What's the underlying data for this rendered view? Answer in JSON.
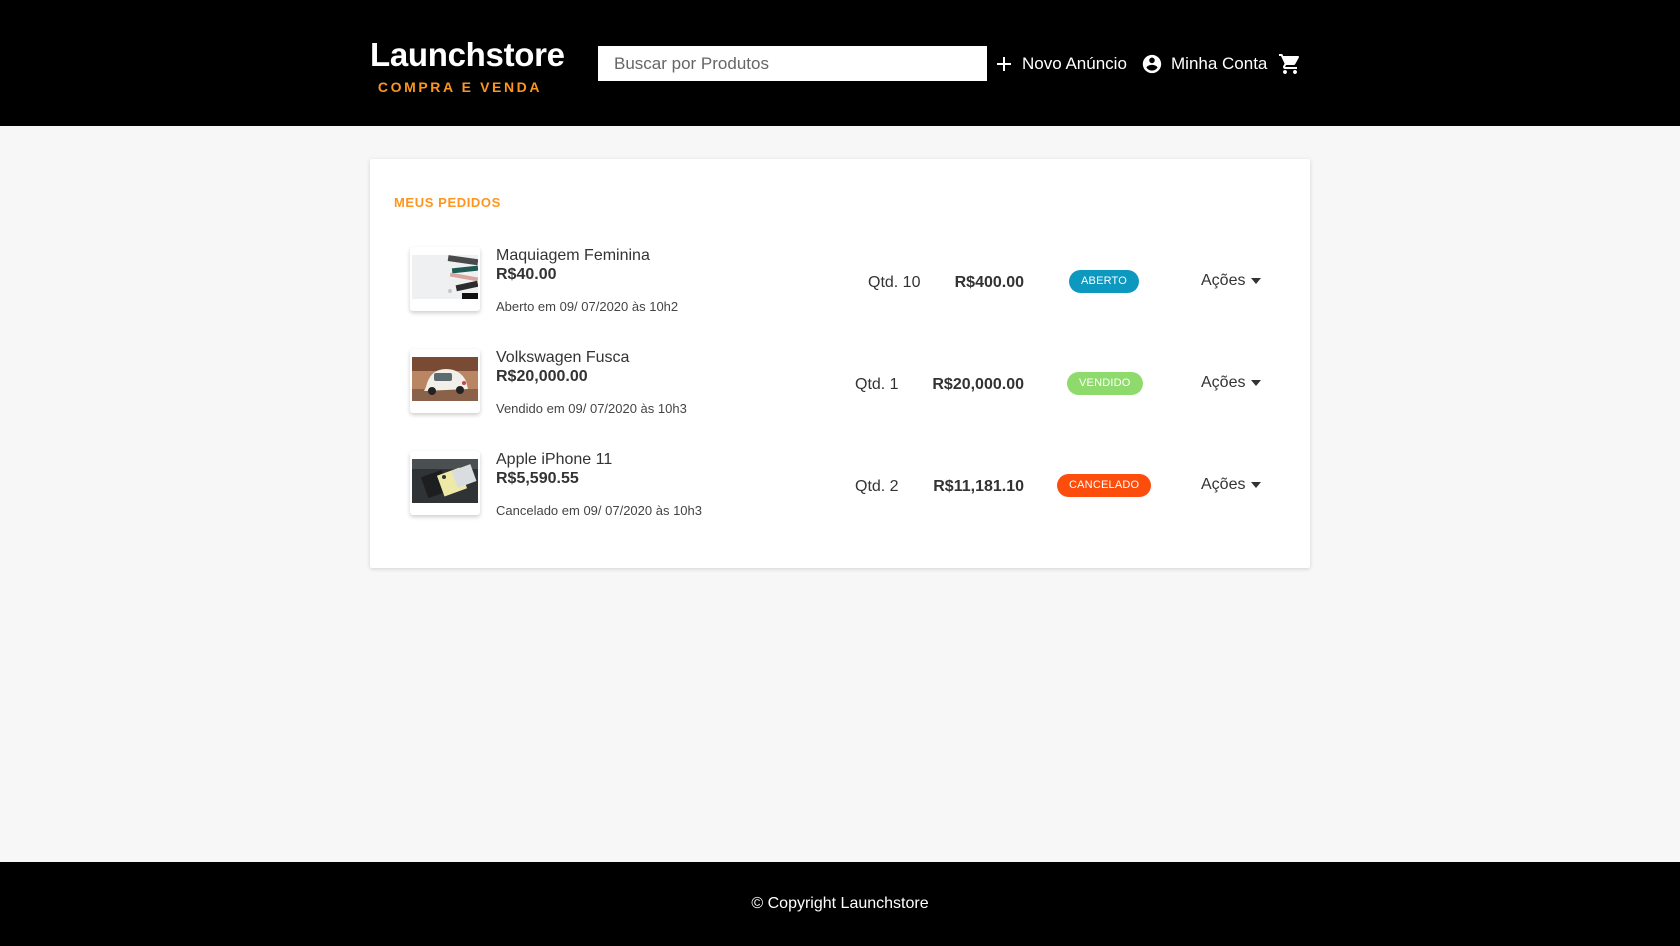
{
  "header": {
    "logo_title": "Launchstore",
    "logo_subtitle": "COMPRA E VENDA",
    "search_placeholder": "Buscar por Produtos",
    "new_ad_label": "Novo Anúncio",
    "account_label": "Minha Conta"
  },
  "orders_section": {
    "title": "MEUS PEDIDOS",
    "orders": [
      {
        "name": "Maquiagem Feminina",
        "unit_price": "R$40.00",
        "date": "Aberto em 09/ 07/2020 às 10h2",
        "quantity": "Qtd. 10",
        "total": "R$400.00",
        "status": "ABERTO",
        "status_color": "#0d98c0",
        "actions_label": "Ações"
      },
      {
        "name": "Volkswagen Fusca",
        "unit_price": "R$20,000.00",
        "date": "Vendido em 09/ 07/2020 às 10h3",
        "quantity": "Qtd. 1",
        "total": "R$20,000.00",
        "status": "VENDIDO",
        "status_color": "#8fda6d",
        "actions_label": "Ações"
      },
      {
        "name": "Apple iPhone 11",
        "unit_price": "R$5,590.55",
        "date": "Cancelado em 09/ 07/2020 às 10h3",
        "quantity": "Qtd. 2",
        "total": "R$11,181.10",
        "status": "CANCELADO",
        "status_color": "#fd4d0c",
        "actions_label": "Ações"
      }
    ]
  },
  "footer": {
    "copyright": "© Copyright Launchstore"
  },
  "colors": {
    "accent": "#fd951f",
    "header_bg": "#000000",
    "page_bg": "#f7f7f7"
  }
}
